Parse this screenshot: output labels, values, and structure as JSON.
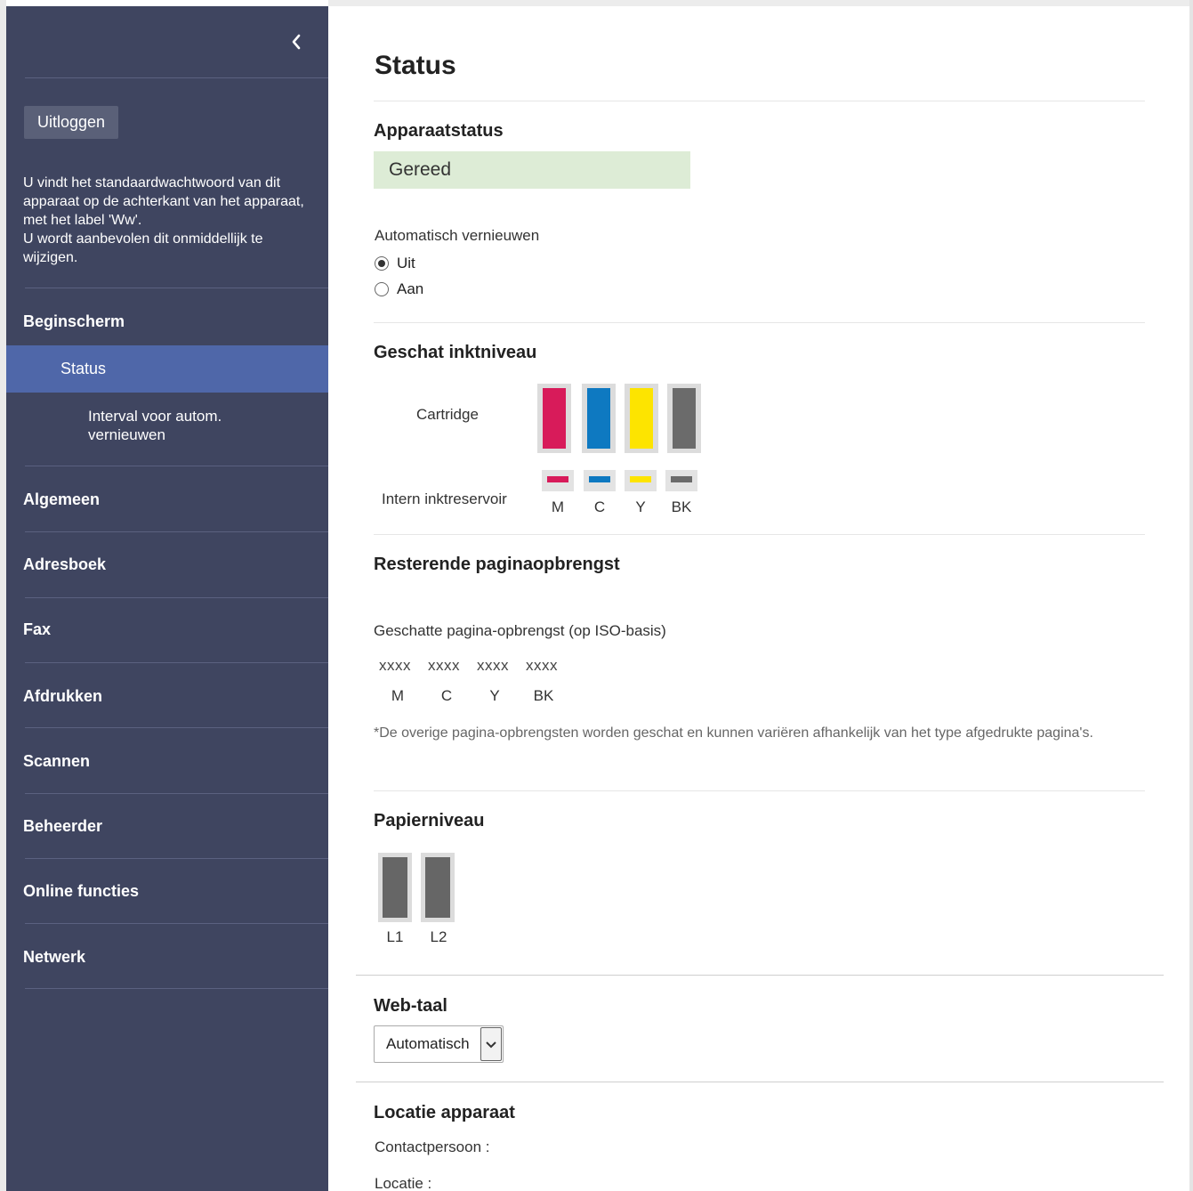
{
  "sidebar": {
    "logout_label": "Uitloggen",
    "password_note": "U vindt het standaardwachtwoord van dit apparaat op de achterkant van het apparaat, met het label 'Ww'.\nU wordt aanbevolen dit onmiddellijk te wijzigen.",
    "nav": {
      "home": "Beginscherm",
      "status": "Status",
      "refresh_interval": "Interval voor autom. vernieuwen",
      "general": "Algemeen",
      "addressbook": "Adresboek",
      "fax": "Fax",
      "print": "Afdrukken",
      "scan": "Scannen",
      "admin": "Beheerder",
      "online": "Online functies",
      "network": "Netwerk"
    },
    "icons": {
      "collapse": "chevron-left-icon"
    }
  },
  "main": {
    "title": "Status",
    "device_status": {
      "heading": "Apparaatstatus",
      "value": "Gereed",
      "color": "#ddecd6"
    },
    "auto_refresh": {
      "label": "Automatisch vernieuwen",
      "options": [
        "Uit",
        "Aan"
      ],
      "selected": "Uit"
    },
    "ink": {
      "heading": "Geschat inktniveau",
      "cartridge_label": "Cartridge",
      "tank_label": "Intern inktreservoir",
      "colors": [
        {
          "letter": "M",
          "hex": "#d81b5a"
        },
        {
          "letter": "C",
          "hex": "#0e79c1"
        },
        {
          "letter": "Y",
          "hex": "#fde400"
        },
        {
          "letter": "BK",
          "hex": "#6b6b6b"
        }
      ]
    },
    "yield": {
      "heading": "Resterende paginaopbrengst",
      "label": "Geschatte pagina-opbrengst (op ISO-basis)",
      "values": [
        "xxxx",
        "xxxx",
        "xxxx",
        "xxxx"
      ],
      "letters": [
        "M",
        "C",
        "Y",
        "BK"
      ],
      "note": "*De overige pagina-opbrengsten worden geschat en kunnen variëren afhankelijk van het type afgedrukte pagina's."
    },
    "paper": {
      "heading": "Papierniveau",
      "trays": [
        "L1",
        "L2"
      ]
    },
    "web_language": {
      "heading": "Web-taal",
      "selected": "Automatisch"
    },
    "location": {
      "heading": "Locatie apparaat",
      "contact_label": "Contactpersoon :",
      "location_label": "Locatie :"
    }
  }
}
